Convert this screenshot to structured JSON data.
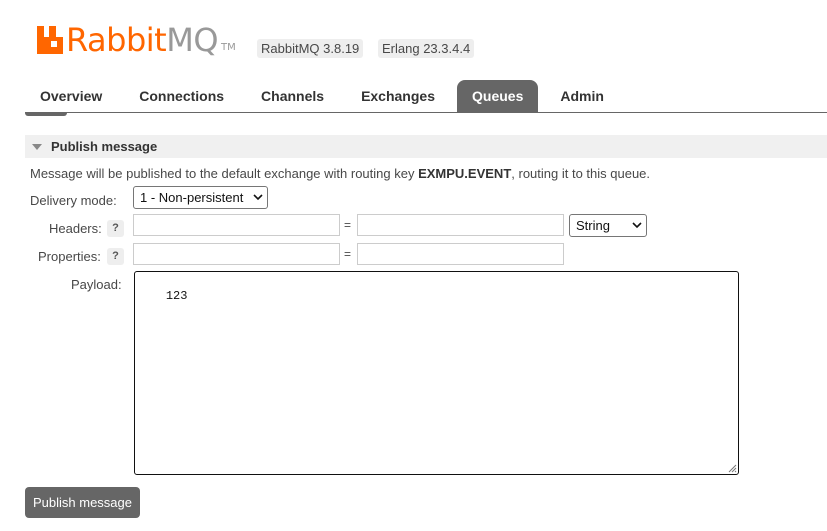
{
  "header": {
    "logo_main": "Rabbit",
    "logo_accent": "MQ",
    "logo_tm": "TM",
    "version_rabbitmq": "RabbitMQ 3.8.19",
    "version_erlang": "Erlang 23.3.4.4"
  },
  "tabs": [
    {
      "label": "Overview",
      "active": false
    },
    {
      "label": "Connections",
      "active": false
    },
    {
      "label": "Channels",
      "active": false
    },
    {
      "label": "Exchanges",
      "active": false
    },
    {
      "label": "Queues",
      "active": true
    },
    {
      "label": "Admin",
      "active": false
    }
  ],
  "section": {
    "title": "Publish message",
    "info_prefix": "Message will be published to the default exchange with routing key ",
    "routing_key": "EXMPU.EVENT",
    "info_suffix": ", routing it to this queue."
  },
  "form": {
    "delivery_mode_label": "Delivery mode:",
    "delivery_mode_value": "1 - Non-persistent",
    "headers_label": "Headers:",
    "properties_label": "Properties:",
    "help_symbol": "?",
    "equals": "=",
    "header_type_value": "String",
    "payload_label": "Payload:",
    "payload_value": "123"
  },
  "publish_button_label": "Publish message",
  "colors": {
    "brand": "#ff6600",
    "tab_active": "#666666",
    "button": "#666666"
  }
}
